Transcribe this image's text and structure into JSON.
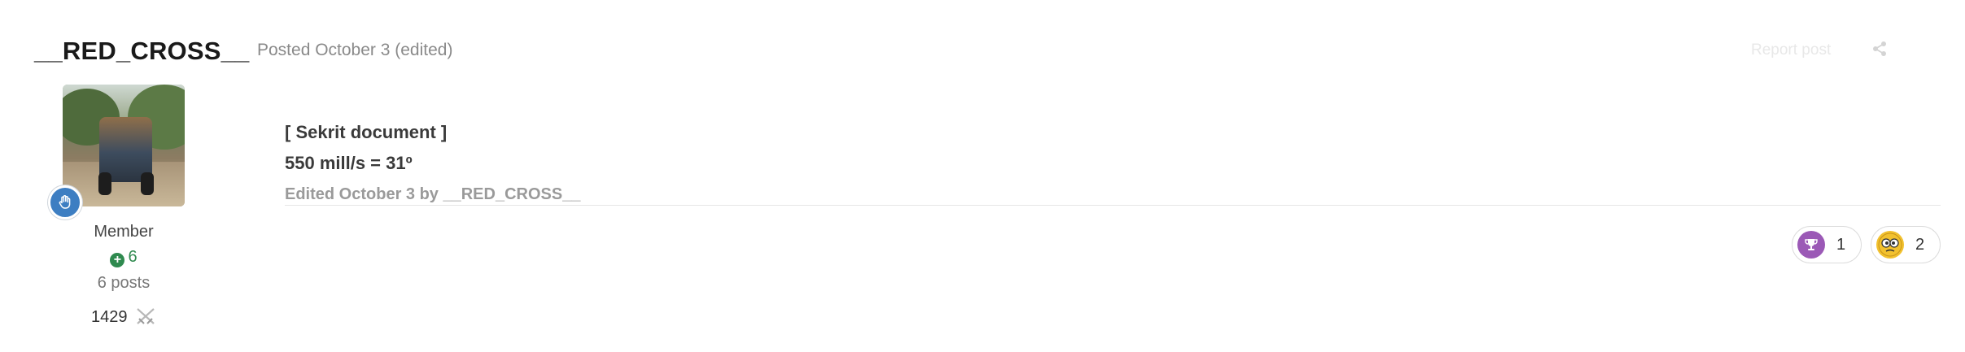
{
  "author": {
    "name": "__RED_CROSS__",
    "rank": "Member",
    "reputation": "6",
    "posts": "6 posts",
    "points": "1429"
  },
  "post": {
    "meta": "Posted October 3 (edited)",
    "report_label": "Report post",
    "body_line1": "[ Sekrit document ]",
    "body_line2": "550 mill/s = 31º",
    "edited_note": "Edited October 3 by __RED_CROSS__"
  },
  "reactions": [
    {
      "icon": "trophy-icon",
      "count": "1",
      "color": "#9b59b6"
    },
    {
      "icon": "confused-face-icon",
      "count": "2",
      "color": "#f2c12e"
    }
  ],
  "colors": {
    "badge": "#3d7ec2",
    "reputation": "#2f8a4f"
  }
}
